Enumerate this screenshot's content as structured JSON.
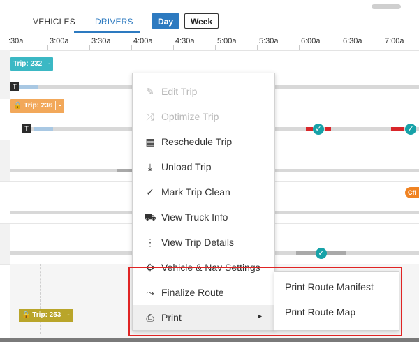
{
  "tabs": [
    {
      "label": "VEHICLES",
      "active": false
    },
    {
      "label": "DRIVERS",
      "active": true
    }
  ],
  "view_toggle": {
    "day_label": "Day",
    "week_label": "Week",
    "selected": "Day"
  },
  "timeline": {
    "times": [
      ":30a",
      "3:00a",
      "3:30a",
      "4:00a",
      "4:30a",
      "5:00a",
      "5:30a",
      "6:00a",
      "6:30a",
      "7:00a"
    ]
  },
  "trips": [
    {
      "label": "Trip: 232",
      "extra": "-",
      "color": "#3bb8c4",
      "locked": false
    },
    {
      "label": "Trip: 236",
      "extra": "-",
      "color": "#f2a85a",
      "locked": true
    },
    {
      "label": "Trip: 253",
      "extra": "-",
      "color": "#b9a52a",
      "locked": true
    }
  ],
  "truck_marker": "T",
  "orange_tag": "Cfi",
  "context_menu": {
    "items": [
      {
        "label": "Edit Trip",
        "icon": "pencil-icon",
        "disabled": true
      },
      {
        "label": "Optimize Trip",
        "icon": "optimize-route-icon",
        "disabled": true
      },
      {
        "label": "Reschedule Trip",
        "icon": "reschedule-icon",
        "disabled": false
      },
      {
        "label": "Unload Trip",
        "icon": "download-icon",
        "disabled": false
      },
      {
        "label": "Mark Trip Clean",
        "icon": "checkmark-icon",
        "disabled": false
      },
      {
        "label": "View Truck Info",
        "icon": "truck-info-icon",
        "disabled": false
      },
      {
        "label": "View Trip Details",
        "icon": "trip-details-icon",
        "disabled": false
      },
      {
        "label": "Vehicle & Nav Settings",
        "icon": "settings-icon",
        "disabled": false
      },
      {
        "label": "Finalize Route",
        "icon": "route-icon",
        "disabled": false
      },
      {
        "label": "Print",
        "icon": "printer-icon",
        "disabled": false,
        "has_submenu": true
      }
    ],
    "submenu_arrow": "►"
  },
  "print_submenu": {
    "items": [
      {
        "label": "Print Route Manifest"
      },
      {
        "label": "Print Route Map"
      }
    ]
  },
  "colors": {
    "accent": "#2d7ac0",
    "highlight_box": "#e02424",
    "check": "#17a2a8"
  }
}
